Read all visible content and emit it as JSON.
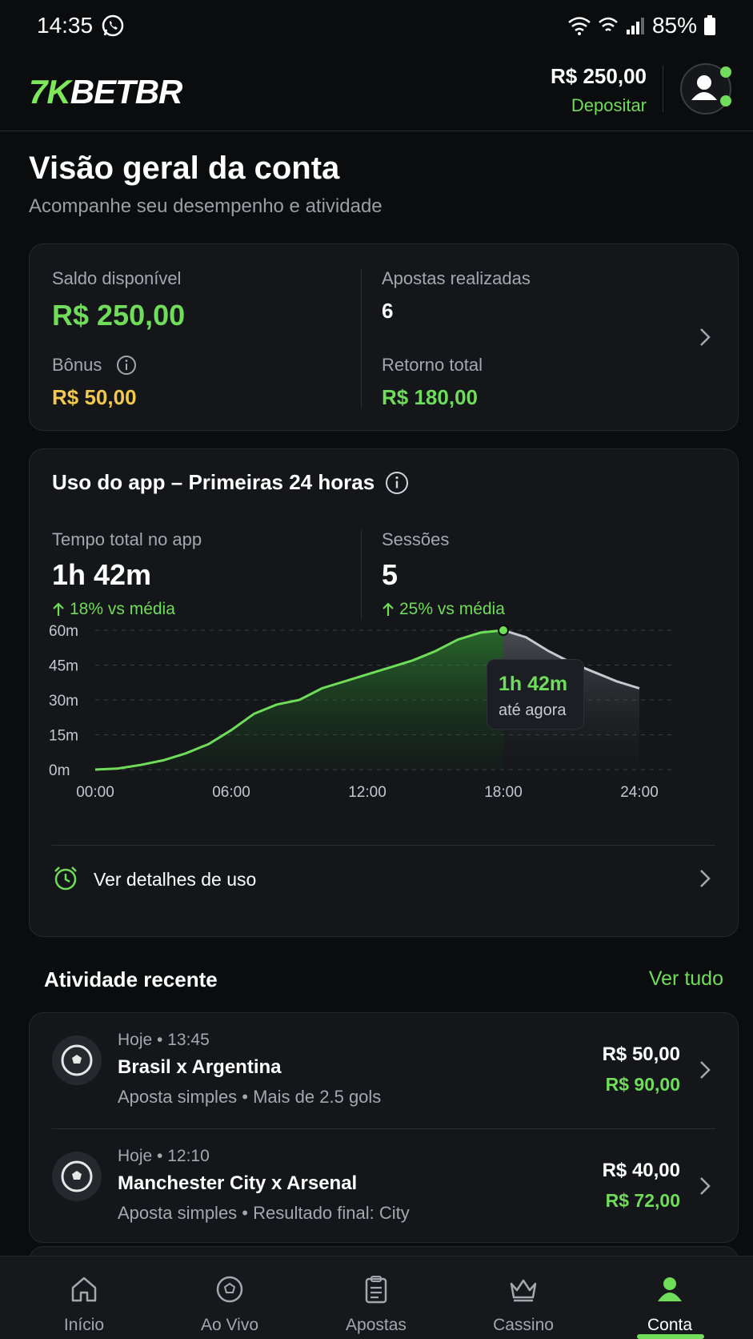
{
  "status_bar": {
    "time": "14:35",
    "battery": "85%"
  },
  "header": {
    "logo_mark": "7K",
    "logo_text": "BETBR",
    "balance": "R$ 250,00",
    "deposit_label": "Depositar"
  },
  "page": {
    "title": "Visão geral da conta",
    "subtitle": "Acompanhe seu desempenho e atividade"
  },
  "summary": {
    "available_label": "Saldo disponível",
    "available_value": "R$ 250,00",
    "bonus_label": "Bônus",
    "bonus_value": "R$ 50,00",
    "bets_label": "Apostas realizadas",
    "bets_value": "6",
    "return_label": "Retorno total",
    "return_value": "R$ 180,00"
  },
  "usage": {
    "title": "Uso do app – Primeiras 24 horas",
    "total_label": "Tempo total no app",
    "total_value": "1h 42m",
    "total_delta": "18% vs média",
    "sessions_label": "Sessões",
    "sessions_value": "5",
    "sessions_delta": "25% vs média",
    "tooltip_value": "1h 42m",
    "tooltip_sub": "até agora",
    "details_label": "Ver detalhes de uso"
  },
  "chart_data": {
    "type": "area",
    "x": [
      "00:00",
      "01:00",
      "02:00",
      "03:00",
      "04:00",
      "05:00",
      "06:00",
      "07:00",
      "08:00",
      "09:00",
      "10:00",
      "11:00",
      "12:00",
      "13:00",
      "14:00",
      "15:00",
      "16:00",
      "17:00",
      "18:00",
      "19:00",
      "20:00",
      "21:00",
      "22:00",
      "23:00",
      "24:00"
    ],
    "values": [
      0,
      0.5,
      2,
      4,
      7,
      11,
      17,
      24,
      28,
      30,
      35,
      38,
      41,
      44,
      47,
      51,
      56,
      59,
      60,
      57,
      51,
      46,
      42,
      38,
      35
    ],
    "x_ticks": [
      "00:00",
      "06:00",
      "12:00",
      "18:00",
      "24:00"
    ],
    "y_ticks": [
      "0m",
      "15m",
      "30m",
      "45m",
      "60m"
    ],
    "ylim": [
      0,
      60
    ],
    "highlight_index": 18,
    "accent": "#6fdc5a",
    "grid": true
  },
  "activity": {
    "title": "Atividade recente",
    "see_all": "Ver tudo",
    "items": [
      {
        "time": "Hoje • 13:45",
        "title": "Brasil x Argentina",
        "desc": "Aposta simples • Mais de 2.5 gols",
        "stake": "R$ 50,00",
        "return": "R$ 90,00"
      },
      {
        "time": "Hoje • 12:10",
        "title": "Manchester City x Arsenal",
        "desc": "Aposta simples • Resultado final: City",
        "stake": "R$ 40,00",
        "return": "R$ 72,00"
      }
    ]
  },
  "nav": {
    "items": [
      {
        "label": "Início",
        "icon": "home-icon"
      },
      {
        "label": "Ao Vivo",
        "icon": "soccer-ball-icon"
      },
      {
        "label": "Apostas",
        "icon": "clipboard-icon"
      },
      {
        "label": "Cassino",
        "icon": "crown-icon"
      },
      {
        "label": "Conta",
        "icon": "user-icon"
      }
    ],
    "active_index": 4
  },
  "colors": {
    "accent": "#6fdc5a",
    "bonus": "#f2c94c",
    "background": "#0b0c0e",
    "card": "#141619"
  }
}
